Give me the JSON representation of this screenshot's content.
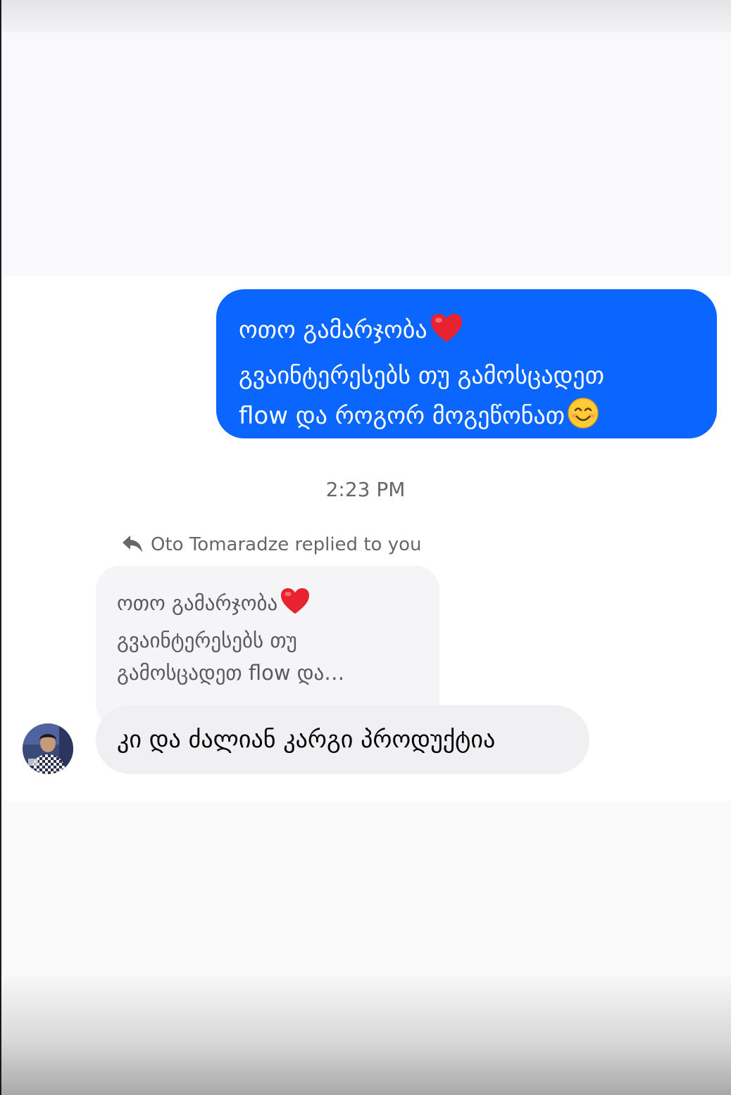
{
  "sent_message": {
    "lines": [
      "ოთო გამარჯობა",
      "გვაინტერესებს თუ გამოსცადეთ",
      "flow და როგორ მოგეწონათ"
    ],
    "line_emojis": [
      "red-heart",
      "",
      "smiling-face"
    ]
  },
  "timestamp": "2:23 PM",
  "reply_header": {
    "icon": "reply-arrow-icon",
    "text": "Oto Tomaradze replied to you"
  },
  "quoted_message": {
    "lines": [
      "ოთო გამარჯობა",
      "გვაინტერესებს თუ",
      "გამოსცადეთ flow და…"
    ]
  },
  "received_message": {
    "text": "კი და ძალიან კარგი პროდუქტია",
    "sender_avatar": "user-avatar"
  },
  "colors": {
    "sent_bubble": "#0a66ff",
    "received_bubble": "#f0f0f2",
    "quoted_bubble": "#f5f5f7",
    "meta_text": "#65676b"
  }
}
